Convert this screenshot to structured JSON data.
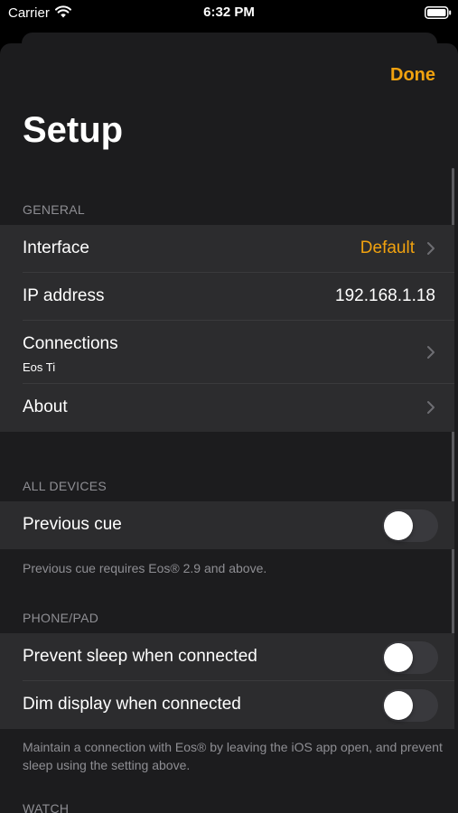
{
  "status_bar": {
    "carrier": "Carrier",
    "time": "6:32 PM"
  },
  "header": {
    "done_label": "Done",
    "title": "Setup"
  },
  "general": {
    "header": "GENERAL",
    "interface": {
      "label": "Interface",
      "value": "Default"
    },
    "ip_address": {
      "label": "IP address",
      "value": "192.168.1.18"
    },
    "connections": {
      "label": "Connections",
      "sublabel": "Eos Ti"
    },
    "about": {
      "label": "About"
    }
  },
  "all_devices": {
    "header": "ALL DEVICES",
    "previous_cue": {
      "label": "Previous cue",
      "enabled": false
    },
    "footer": "Previous cue requires Eos® 2.9 and above."
  },
  "phone_pad": {
    "header": "PHONE/PAD",
    "prevent_sleep": {
      "label": "Prevent sleep when connected",
      "enabled": false
    },
    "dim_display": {
      "label": "Dim display when connected",
      "enabled": false
    },
    "footer": "Maintain a connection with Eos® by leaving the iOS app open, and prevent sleep using the setting above."
  },
  "watch": {
    "header": "WATCH"
  },
  "colors": {
    "accent": "#f1a20f",
    "sheet_background": "#1c1c1e",
    "row_background": "#2c2c2e",
    "secondary_text": "#8e8e93"
  },
  "icons": {
    "wifi": "wifi-icon",
    "battery": "battery-icon",
    "chevron": "chevron-right-icon"
  }
}
